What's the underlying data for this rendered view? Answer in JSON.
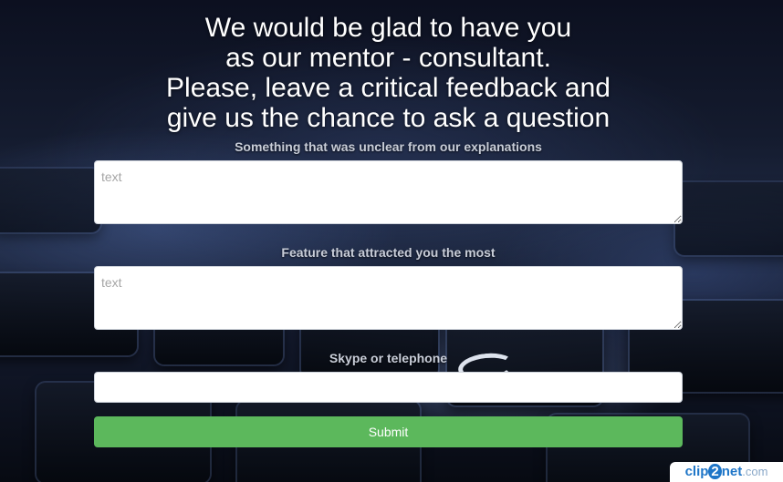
{
  "headline": {
    "lines": [
      "We would be glad to have you",
      "as our mentor - consultant.",
      "Please, leave a critical feedback and",
      "give us the chance to ask a question"
    ]
  },
  "form": {
    "unclear": {
      "label": "Something that was unclear from our explanations",
      "placeholder": "text",
      "value": ""
    },
    "feature": {
      "label": "Feature that attracted you the most",
      "placeholder": "text",
      "value": ""
    },
    "contact": {
      "label": "Skype or telephone",
      "placeholder": "",
      "value": ""
    },
    "submit_label": "Submit"
  },
  "watermark": {
    "part_a": "clip",
    "part_b": "2",
    "part_c": "net",
    "part_d": ".com"
  },
  "colors": {
    "submit": "#5cb85c",
    "text": "#ffffff",
    "label": "#c8cdd8"
  }
}
